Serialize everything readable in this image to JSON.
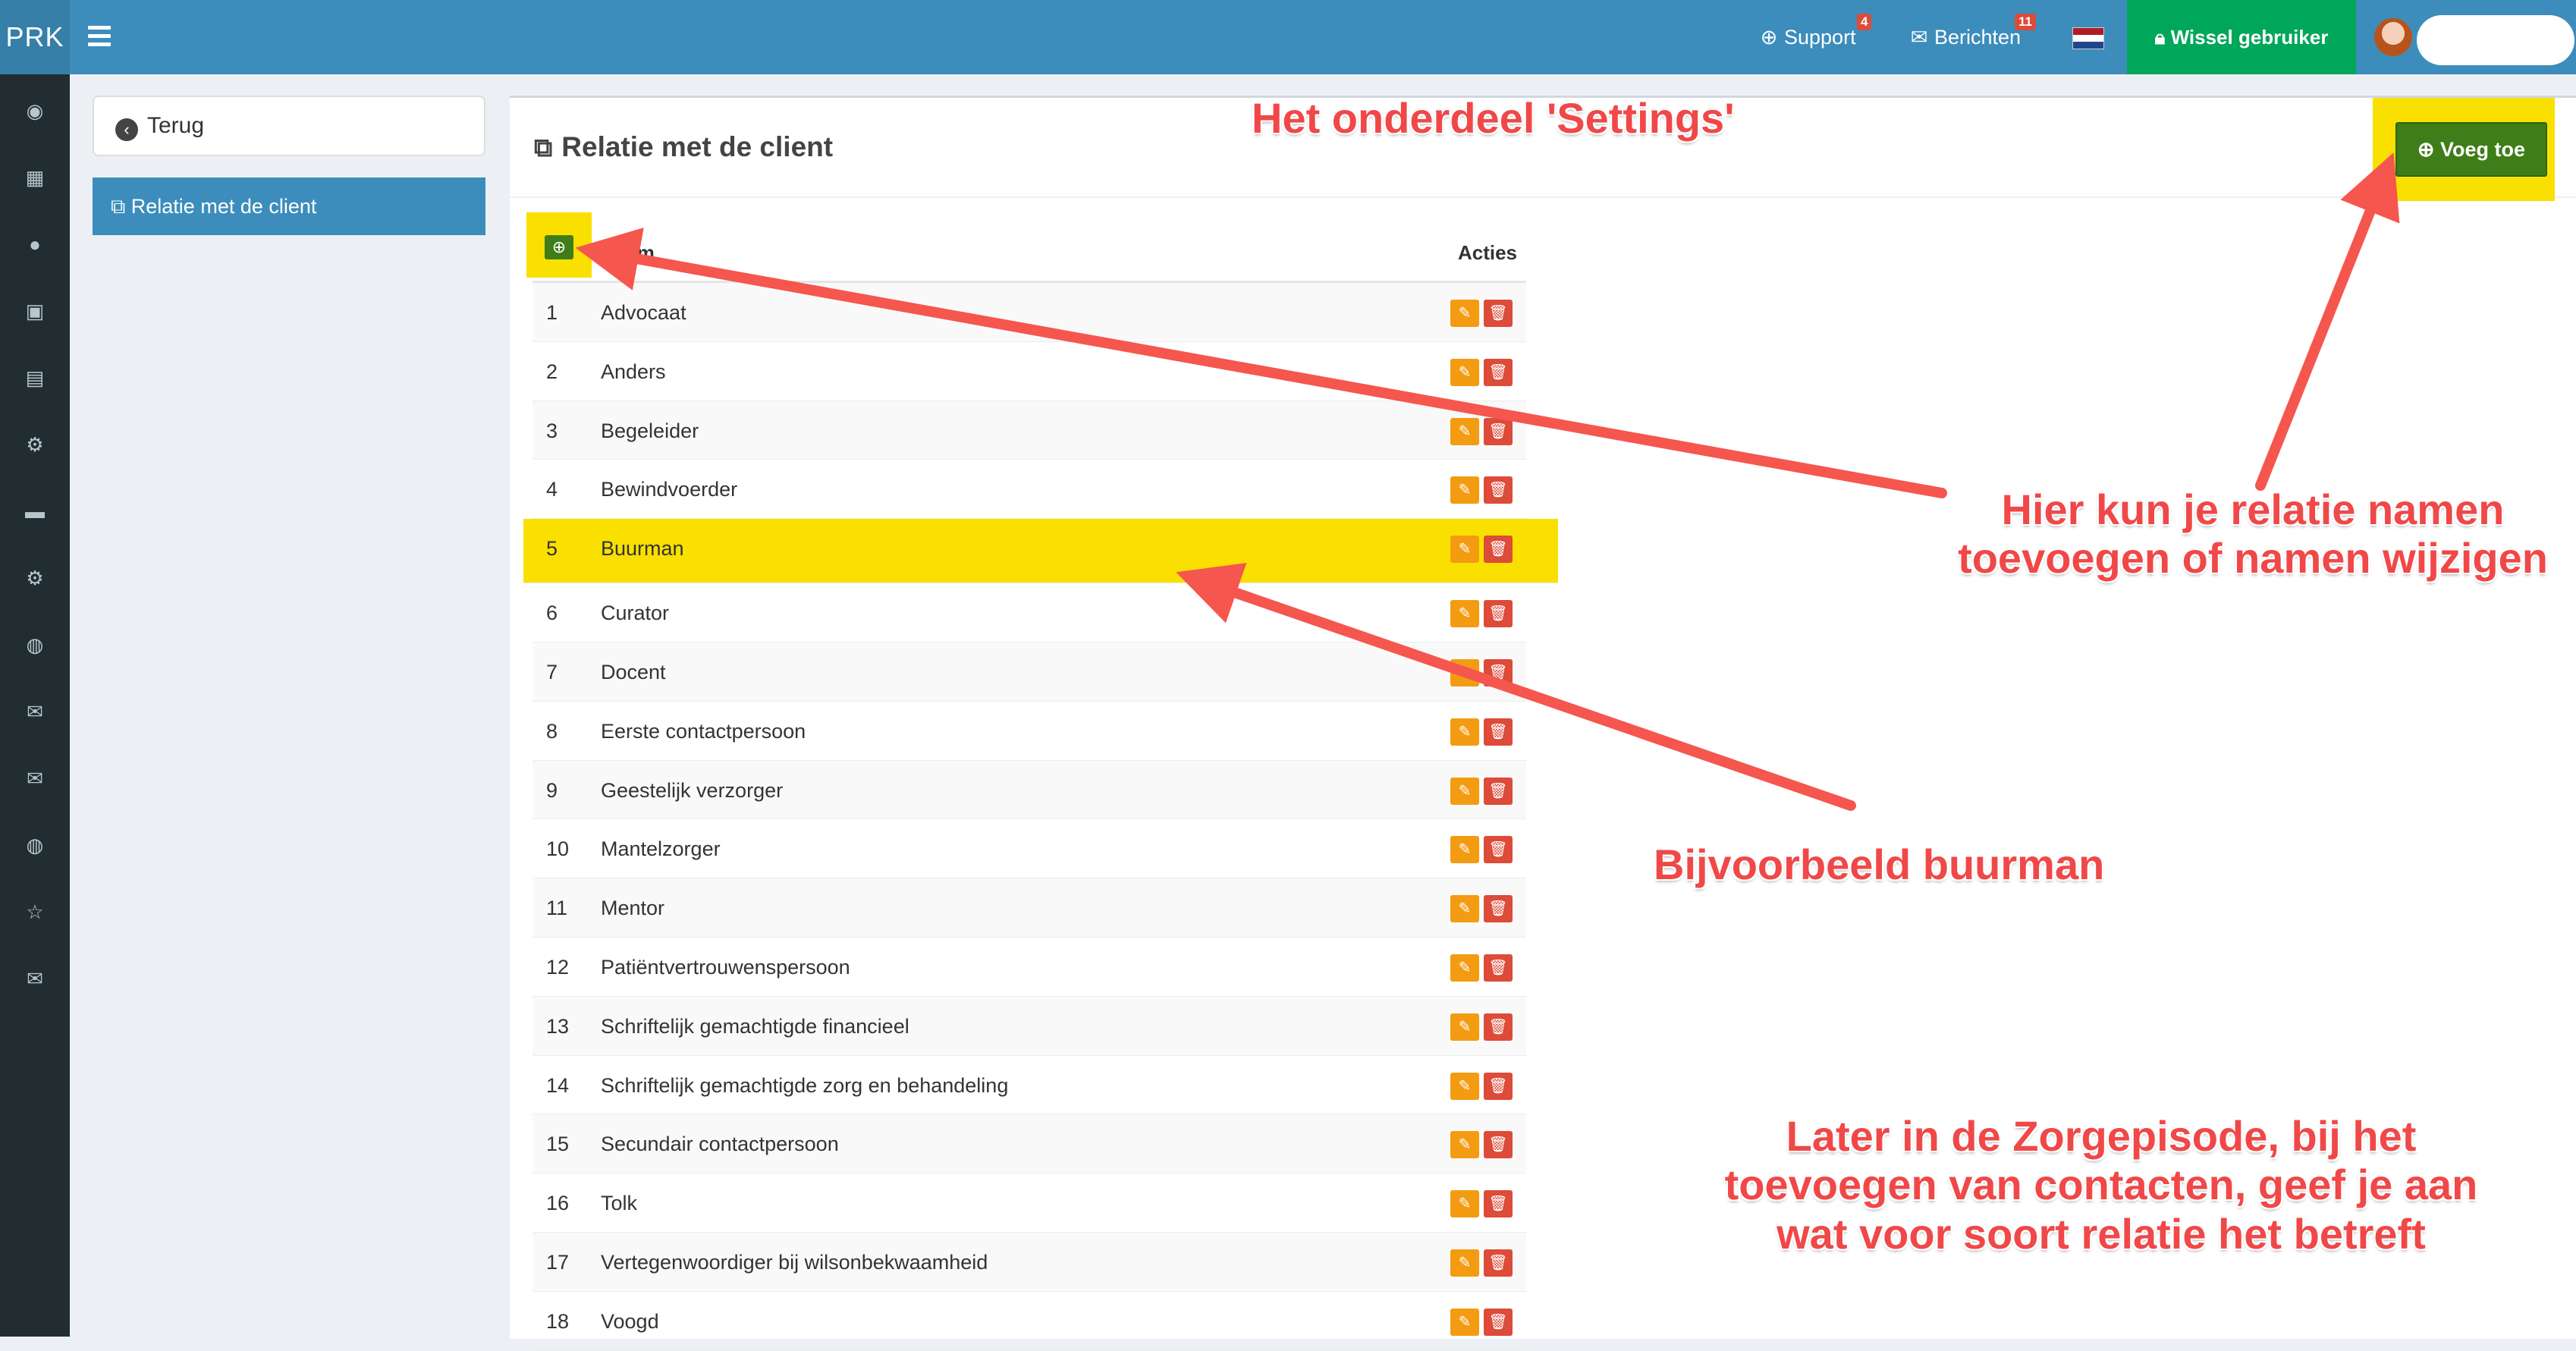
{
  "app": {
    "logo": "PRK"
  },
  "topnav": {
    "support": {
      "label": "Support",
      "badge": "4"
    },
    "berichten": {
      "label": "Berichten",
      "badge": "11"
    },
    "wissel": "Wissel gebruiker"
  },
  "left": {
    "back_label": "Terug",
    "active_item": "Relatie met de client"
  },
  "panel": {
    "title": "Relatie met de client",
    "add_label": "Voeg toe",
    "col_name": "Naam",
    "col_actions": "Acties"
  },
  "rows": [
    {
      "n": "1",
      "name": "Advocaat"
    },
    {
      "n": "2",
      "name": "Anders"
    },
    {
      "n": "3",
      "name": "Begeleider"
    },
    {
      "n": "4",
      "name": "Bewindvoerder"
    },
    {
      "n": "5",
      "name": "Buurman"
    },
    {
      "n": "6",
      "name": "Curator"
    },
    {
      "n": "7",
      "name": "Docent"
    },
    {
      "n": "8",
      "name": "Eerste contactpersoon"
    },
    {
      "n": "9",
      "name": "Geestelijk verzorger"
    },
    {
      "n": "10",
      "name": "Mantelzorger"
    },
    {
      "n": "11",
      "name": "Mentor"
    },
    {
      "n": "12",
      "name": "Patiëntvertrouwenspersoon"
    },
    {
      "n": "13",
      "name": "Schriftelijk gemachtigde financieel"
    },
    {
      "n": "14",
      "name": "Schriftelijk gemachtigde zorg en behandeling"
    },
    {
      "n": "15",
      "name": "Secundair contactpersoon"
    },
    {
      "n": "16",
      "name": "Tolk"
    },
    {
      "n": "17",
      "name": "Vertegenwoordiger bij wilsonbekwaamheid"
    },
    {
      "n": "18",
      "name": "Voogd"
    }
  ],
  "highlight_row": 5,
  "annotations": {
    "settings": "Het onderdeel 'Settings'",
    "edit_line1": "Hier kun je relatie namen",
    "edit_line2": "toevoegen of namen wijzigen",
    "example": "Bijvoorbeeld buurman",
    "later_line1": "Later in de Zorgepisode, bij het",
    "later_line2": "toevoegen van contacten, geef je aan",
    "later_line3": "wat voor soort relatie het betreft"
  },
  "colors": {
    "topbar": "#3c8dbc",
    "sidebar": "#222d32",
    "highlight": "#f9e000",
    "add_button": "#3e7d18",
    "edit_button": "#f39c12",
    "delete_button": "#dd4b39",
    "annotation": "#f04848"
  },
  "sidebar_icons": [
    "dashboard-icon",
    "calendar-icon",
    "user-icon",
    "medkit-icon",
    "book-icon",
    "cogs-icon",
    "truck-icon",
    "gear-icon",
    "globe-icon",
    "envelope-icon",
    "envelope-icon",
    "globe-icon",
    "star-icon",
    "mail-icon"
  ]
}
